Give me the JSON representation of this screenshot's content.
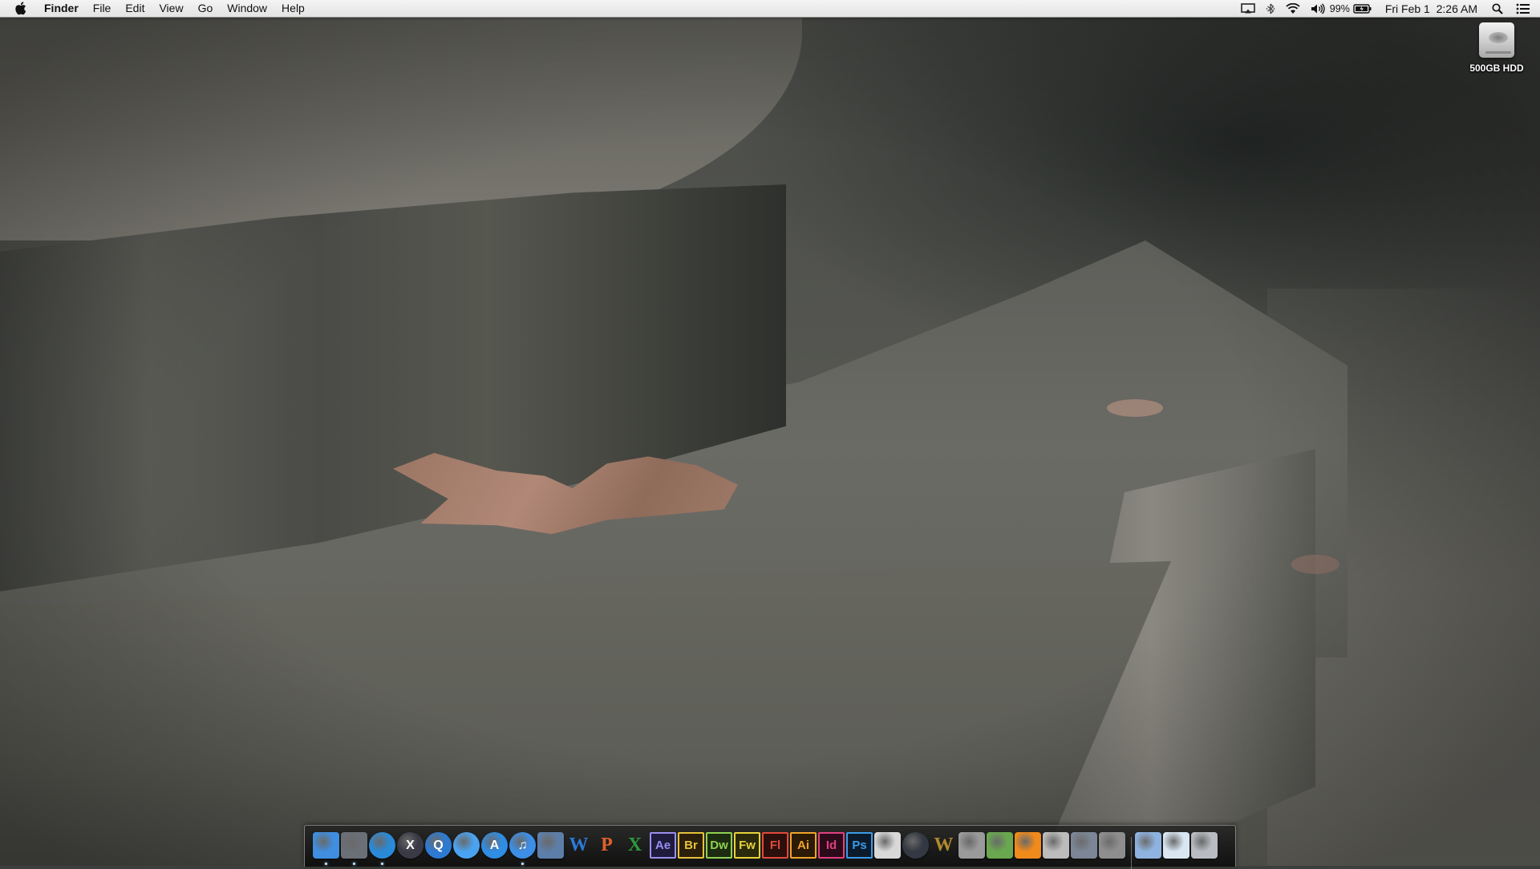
{
  "menubar": {
    "apple_icon": "apple-logo-icon",
    "app_name": "Finder",
    "menus": [
      "File",
      "Edit",
      "View",
      "Go",
      "Window",
      "Help"
    ],
    "status": {
      "icons": [
        "airplay-icon",
        "bluetooth-icon",
        "wifi-icon",
        "volume-icon"
      ],
      "battery_percent": "99%",
      "battery_icon": "battery-icon",
      "clock": "Fri Feb 1  2:26 AM",
      "search_icon": "spotlight-icon",
      "notifications_icon": "notification-center-icon"
    }
  },
  "desktop": {
    "icons": [
      {
        "label": "500GB HDD",
        "icon": "hard-drive-icon"
      }
    ]
  },
  "dock": {
    "items": [
      {
        "name": "finder",
        "text": "",
        "color": "#3f8ee0",
        "running": true
      },
      {
        "name": "launchpad",
        "text": "",
        "color": "#6b6f77",
        "running": true
      },
      {
        "name": "safari",
        "text": "",
        "color": "#2a8ad8",
        "running": true
      },
      {
        "name": "mission-control",
        "text": "X",
        "color": "#3a3a46",
        "running": false
      },
      {
        "name": "quicktime",
        "text": "Q",
        "color": "#2d7ad2",
        "running": false
      },
      {
        "name": "messages",
        "text": "",
        "color": "#4aa3f0",
        "running": false
      },
      {
        "name": "app-store",
        "text": "A",
        "color": "#2f8de4",
        "running": false
      },
      {
        "name": "itunes",
        "text": "♫",
        "color": "#3c8ee6",
        "running": true
      },
      {
        "name": "xcode",
        "text": "",
        "color": "#5d7ea8",
        "running": false
      },
      {
        "name": "word",
        "text": "W",
        "color": "#2b79d9",
        "running": false
      },
      {
        "name": "powerpoint",
        "text": "P",
        "color": "#e0612b",
        "running": false
      },
      {
        "name": "excel",
        "text": "X",
        "color": "#2d9a3c",
        "running": false
      },
      {
        "name": "after-effects",
        "text": "Ae",
        "color": "#9a8ff0",
        "running": false
      },
      {
        "name": "bridge",
        "text": "Br",
        "color": "#e6c23a",
        "running": false
      },
      {
        "name": "dreamweaver",
        "text": "Dw",
        "color": "#8fd14f",
        "running": false
      },
      {
        "name": "fireworks",
        "text": "Fw",
        "color": "#e8d23a",
        "running": false
      },
      {
        "name": "flash",
        "text": "Fl",
        "color": "#e24a3a",
        "running": false
      },
      {
        "name": "illustrator",
        "text": "Ai",
        "color": "#f0a42a",
        "running": false
      },
      {
        "name": "indesign",
        "text": "Id",
        "color": "#e0407e",
        "running": false
      },
      {
        "name": "photoshop",
        "text": "Ps",
        "color": "#3d9ae8",
        "running": false
      },
      {
        "name": "acrobat",
        "text": "",
        "color": "#d8d8d8",
        "running": false
      },
      {
        "name": "dvd-player",
        "text": "",
        "color": "#333842",
        "running": false
      },
      {
        "name": "wow",
        "text": "W",
        "color": "#b08a2c",
        "running": false
      },
      {
        "name": "steam",
        "text": "",
        "color": "#9a9a9a",
        "running": false
      },
      {
        "name": "minecraft",
        "text": "",
        "color": "#6aa84f",
        "running": false
      },
      {
        "name": "vlc",
        "text": "",
        "color": "#f08a1c",
        "running": false
      },
      {
        "name": "script-editor",
        "text": "",
        "color": "#bcbcbc",
        "running": false
      },
      {
        "name": "screen-capture",
        "text": "",
        "color": "#7c8696",
        "running": false
      },
      {
        "name": "system-preferences",
        "text": "",
        "color": "#8e8e8e",
        "running": false
      },
      {
        "name": "downloads-stack",
        "text": "",
        "color": "#8fb3e0",
        "running": false
      },
      {
        "name": "documents-stack",
        "text": "",
        "color": "#d9e6f2",
        "running": false
      },
      {
        "name": "trash",
        "text": "",
        "color": "#b8bcc2",
        "running": false
      }
    ]
  }
}
